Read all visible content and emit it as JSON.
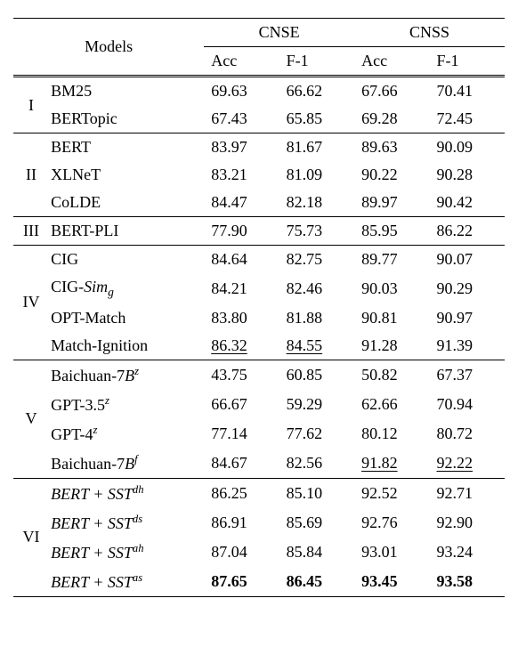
{
  "chart_data": {
    "type": "table",
    "title": "",
    "header": {
      "models": "Models",
      "groups": [
        {
          "name": "CNSE",
          "cols": [
            "Acc",
            "F-1"
          ]
        },
        {
          "name": "CNSS",
          "cols": [
            "Acc",
            "F-1"
          ]
        }
      ]
    },
    "sections": [
      {
        "id": "I",
        "rows": [
          {
            "model": "BM25",
            "cnse_acc": "69.63",
            "cnse_f1": "66.62",
            "cnss_acc": "67.66",
            "cnss_f1": "70.41"
          },
          {
            "model": "BERTopic",
            "cnse_acc": "67.43",
            "cnse_f1": "65.85",
            "cnss_acc": "69.28",
            "cnss_f1": "72.45"
          }
        ]
      },
      {
        "id": "II",
        "rows": [
          {
            "model": "BERT",
            "cnse_acc": "83.97",
            "cnse_f1": "81.67",
            "cnss_acc": "89.63",
            "cnss_f1": "90.09"
          },
          {
            "model": "XLNeT",
            "cnse_acc": "83.21",
            "cnse_f1": "81.09",
            "cnss_acc": "90.22",
            "cnss_f1": "90.28"
          },
          {
            "model": "CoLDE",
            "cnse_acc": "84.47",
            "cnse_f1": "82.18",
            "cnss_acc": "89.97",
            "cnss_f1": "90.42"
          }
        ]
      },
      {
        "id": "III",
        "rows": [
          {
            "model": "BERT-PLI",
            "cnse_acc": "77.90",
            "cnse_f1": "75.73",
            "cnss_acc": "85.95",
            "cnss_f1": "86.22"
          }
        ]
      },
      {
        "id": "IV",
        "rows": [
          {
            "model": "CIG",
            "cnse_acc": "84.64",
            "cnse_f1": "82.75",
            "cnss_acc": "89.77",
            "cnss_f1": "90.07"
          },
          {
            "model_html": "CIG-<span class='italic'>Sim<sub>g</sub></span>",
            "cnse_acc": "84.21",
            "cnse_f1": "82.46",
            "cnss_acc": "90.03",
            "cnss_f1": "90.29"
          },
          {
            "model": "OPT-Match",
            "cnse_acc": "83.80",
            "cnse_f1": "81.88",
            "cnss_acc": "90.81",
            "cnss_f1": "90.97"
          },
          {
            "model": "Match-Ignition",
            "cnse_acc": "86.32",
            "cnse_f1": "84.55",
            "cnss_acc": "91.28",
            "cnss_f1": "91.39",
            "underline_cols": [
              "cnse_acc",
              "cnse_f1"
            ]
          }
        ]
      },
      {
        "id": "V",
        "rows": [
          {
            "model_html": "Baichuan-7<span class='italic'>B<sup>z</sup></span>",
            "cnse_acc": "43.75",
            "cnse_f1": "60.85",
            "cnss_acc": "50.82",
            "cnss_f1": "67.37"
          },
          {
            "model_html": "GPT-3.5<span class='italic'><sup>z</sup></span>",
            "cnse_acc": "66.67",
            "cnse_f1": "59.29",
            "cnss_acc": "62.66",
            "cnss_f1": "70.94"
          },
          {
            "model_html": "GPT-4<span class='italic'><sup>z</sup></span>",
            "cnse_acc": "77.14",
            "cnse_f1": "77.62",
            "cnss_acc": "80.12",
            "cnss_f1": "80.72"
          },
          {
            "model_html": "Baichuan-7<span class='italic'>B<sup>f</sup></span>",
            "cnse_acc": "84.67",
            "cnse_f1": "82.56",
            "cnss_acc": "91.82",
            "cnss_f1": "92.22",
            "underline_cols": [
              "cnss_acc",
              "cnss_f1"
            ]
          }
        ]
      },
      {
        "id": "VI",
        "rows": [
          {
            "model_html": "<span class='italic'>BERT + SST<sup>dh</sup></span>",
            "cnse_acc": "86.25",
            "cnse_f1": "85.10",
            "cnss_acc": "92.52",
            "cnss_f1": "92.71"
          },
          {
            "model_html": "<span class='italic'>BERT + SST<sup>ds</sup></span>",
            "cnse_acc": "86.91",
            "cnse_f1": "85.69",
            "cnss_acc": "92.76",
            "cnss_f1": "92.90"
          },
          {
            "model_html": "<span class='italic'>BERT + SST<sup>ah</sup></span>",
            "cnse_acc": "87.04",
            "cnse_f1": "85.84",
            "cnss_acc": "93.01",
            "cnss_f1": "93.24"
          },
          {
            "model_html": "<span class='italic'>BERT + SST<sup>as</sup></span>",
            "cnse_acc": "87.65",
            "cnse_f1": "86.45",
            "cnss_acc": "93.45",
            "cnss_f1": "93.58",
            "bold_cols": [
              "cnse_acc",
              "cnse_f1",
              "cnss_acc",
              "cnss_f1"
            ]
          }
        ]
      }
    ]
  }
}
